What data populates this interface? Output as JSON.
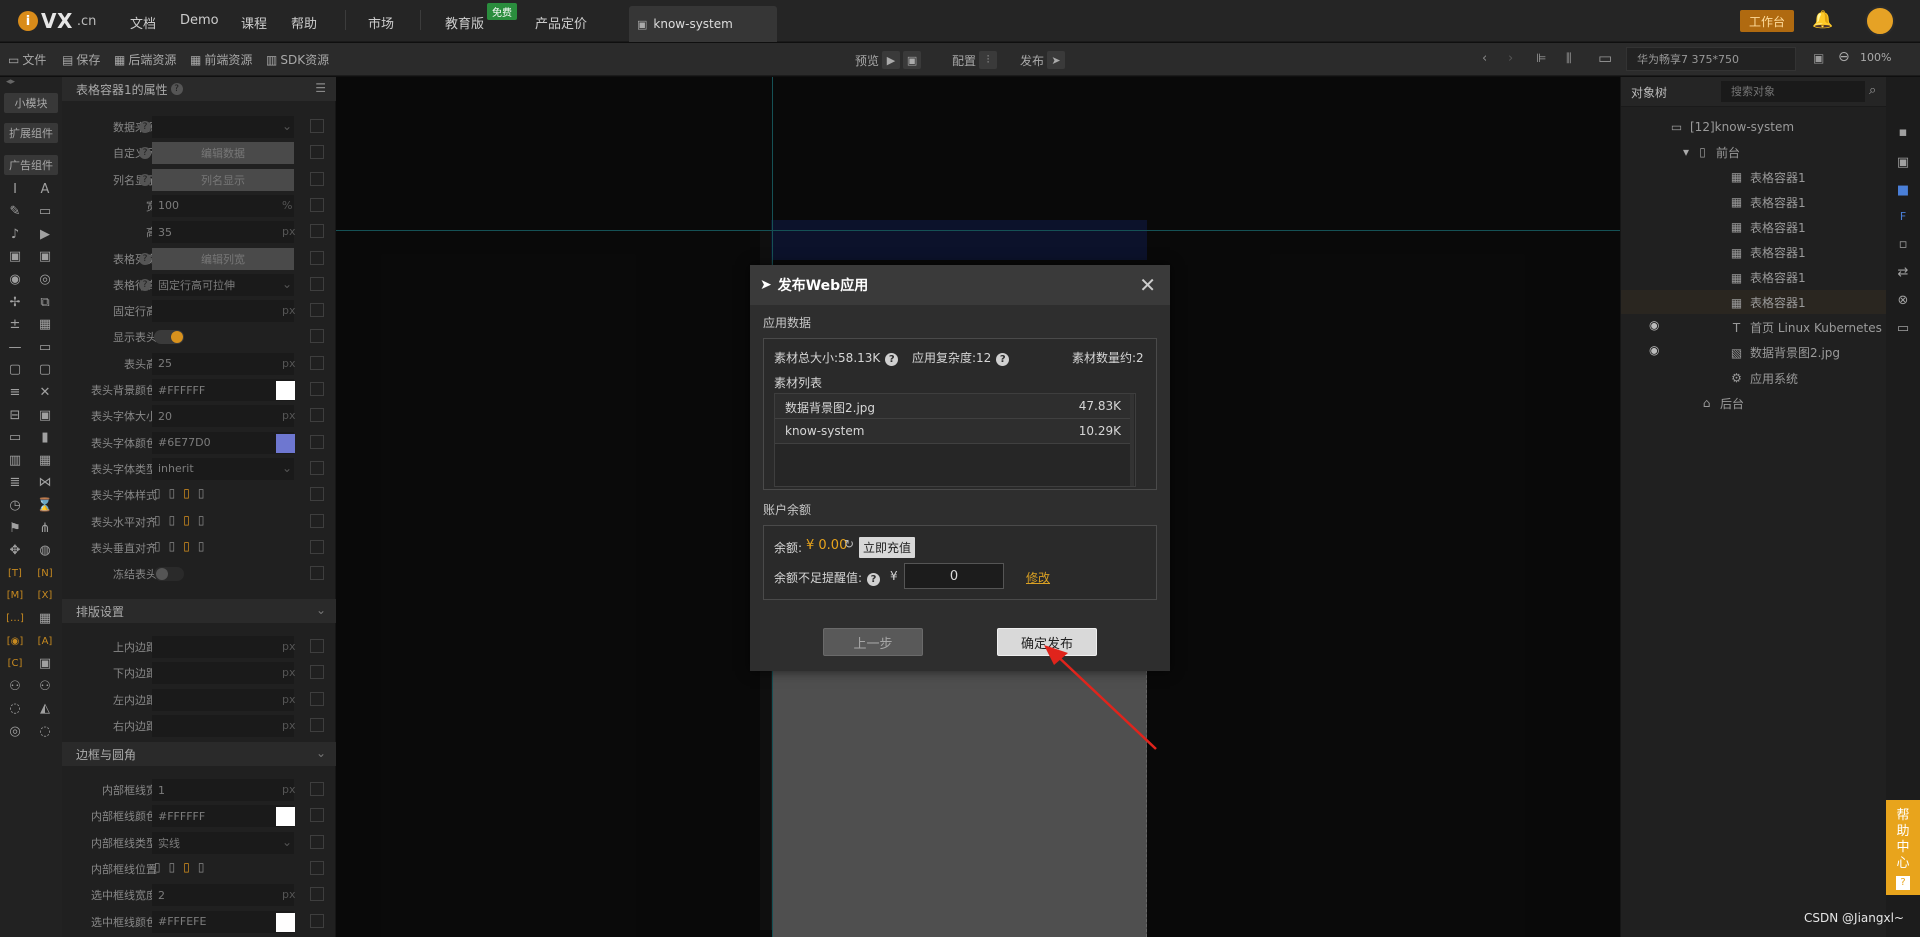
{
  "topbar": {
    "logo_letter": "i",
    "logo_name": "VX",
    "logo_suffix": ".cn",
    "nav": [
      "文档",
      "Demo",
      "课程",
      "帮助",
      "市场",
      "教育版",
      "产品定价"
    ],
    "free_badge": "免费",
    "active_tab": "know-system",
    "workspace_button": "工作台"
  },
  "toolbar": {
    "file": "文件",
    "save": "保存",
    "backend_res": "后端资源",
    "frontend_res": "前端资源",
    "sdk_res": "SDK资源",
    "preview": "预览",
    "config": "配置",
    "publish": "发布",
    "device": "华为畅享7 375*750",
    "zoom": "100%"
  },
  "leftstrip": {
    "buttons": [
      "小模块",
      "扩展组件",
      "广告组件"
    ]
  },
  "props": {
    "title": "表格容器1的属性",
    "rows": [
      {
        "label": "数据来源",
        "type": "select",
        "value": "",
        "help": true
      },
      {
        "label": "自定义列",
        "type": "button",
        "value": "编辑数据",
        "help": true
      },
      {
        "label": "列名显示",
        "type": "button",
        "value": "列名显示",
        "help": true
      },
      {
        "label": "宽",
        "type": "input",
        "value": "100",
        "unit": "%"
      },
      {
        "label": "高",
        "type": "input",
        "value": "35",
        "unit": "px"
      },
      {
        "label": "表格列宽",
        "type": "button",
        "value": "编辑列宽",
        "help": true
      },
      {
        "label": "表格行高",
        "type": "select",
        "value": "固定行高可拉伸",
        "help": true
      },
      {
        "label": "固定行高",
        "type": "input",
        "value": "",
        "unit": "px"
      },
      {
        "label": "显示表头",
        "type": "toggle",
        "value": ""
      },
      {
        "label": "表头高",
        "type": "input",
        "value": "25",
        "unit": "px"
      },
      {
        "label": "表头背景颜色",
        "type": "color",
        "value": "#FFFFFF"
      },
      {
        "label": "表头字体大小",
        "type": "input",
        "value": "20",
        "unit": "px"
      },
      {
        "label": "表头字体颜色",
        "type": "color",
        "value": "#6E77D0"
      },
      {
        "label": "表头字体类型",
        "type": "select",
        "value": "inherit"
      },
      {
        "label": "表头字体样式",
        "type": "icons",
        "value": ""
      },
      {
        "label": "表头水平对齐",
        "type": "icons",
        "value": ""
      },
      {
        "label": "表头垂直对齐",
        "type": "icons",
        "value": ""
      },
      {
        "label": "冻结表头",
        "type": "toggle",
        "value": ""
      }
    ],
    "section_layout": "排版设置",
    "layout_rows": [
      {
        "label": "上内边距",
        "unit": "px"
      },
      {
        "label": "下内边距",
        "unit": "px"
      },
      {
        "label": "左内边距",
        "unit": "px"
      },
      {
        "label": "右内边距",
        "unit": "px"
      }
    ],
    "section_border": "边框与圆角",
    "border_rows": [
      {
        "label": "内部框线宽",
        "type": "input",
        "value": "1",
        "unit": "px"
      },
      {
        "label": "内部框线颜色",
        "type": "color",
        "value": "#FFFFFF"
      },
      {
        "label": "内部框线类型",
        "type": "select",
        "value": "实线"
      },
      {
        "label": "内部框线位置",
        "type": "icons",
        "value": ""
      },
      {
        "label": "选中框线宽度",
        "type": "input",
        "value": "2",
        "unit": "px"
      },
      {
        "label": "选中框线颜色",
        "type": "color",
        "value": "#FFFEFE"
      }
    ]
  },
  "dialog": {
    "title": "发布Web应用",
    "section_app": "应用数据",
    "total_size": "素材总大小:58.13K",
    "complexity": "应用复杂度:12",
    "count": "素材数量约:2",
    "list_title": "素材列表",
    "files": [
      {
        "name": "数据背景图2.jpg",
        "size": "47.83K"
      },
      {
        "name": "know-system",
        "size": "10.29K"
      }
    ],
    "section_balance": "账户余额",
    "balance_label": "余额:",
    "balance_value": "¥ 0.00",
    "recharge": "立即充值",
    "alert_label": "余额不足提醒值:",
    "currency": "¥",
    "alert_value": "0",
    "modify": "修改",
    "prev": "上一步",
    "confirm": "确定发布"
  },
  "objtree": {
    "tab": "对象树",
    "search_placeholder": "搜索对象",
    "nodes": [
      {
        "label": "[12]know-system",
        "depth": 0,
        "icon": "app"
      },
      {
        "label": "前台",
        "depth": 1,
        "icon": "phone"
      },
      {
        "label": "表格容器1",
        "depth": 2,
        "icon": "table"
      },
      {
        "label": "表格容器1",
        "depth": 2,
        "icon": "table"
      },
      {
        "label": "表格容器1",
        "depth": 2,
        "icon": "table"
      },
      {
        "label": "表格容器1",
        "depth": 2,
        "icon": "table"
      },
      {
        "label": "表格容器1",
        "depth": 2,
        "icon": "table"
      },
      {
        "label": "表格容器1",
        "depth": 2,
        "icon": "table",
        "selected": true
      },
      {
        "label": "首页 Linux Kubernetes",
        "depth": 2,
        "icon": "text",
        "eye": true
      },
      {
        "label": "数据背景图2.jpg",
        "depth": 2,
        "icon": "image",
        "eye": true
      },
      {
        "label": "应用系统",
        "depth": 2,
        "icon": "gear"
      },
      {
        "label": "后台",
        "depth": 1,
        "icon": "server"
      }
    ]
  },
  "help_side": [
    "帮",
    "助",
    "中",
    "心"
  ],
  "watermark": "CSDN @Jiangxl~",
  "colors": {
    "accent": "#e8a41c",
    "guide": "#1d6d72",
    "link": "#d9a023"
  }
}
